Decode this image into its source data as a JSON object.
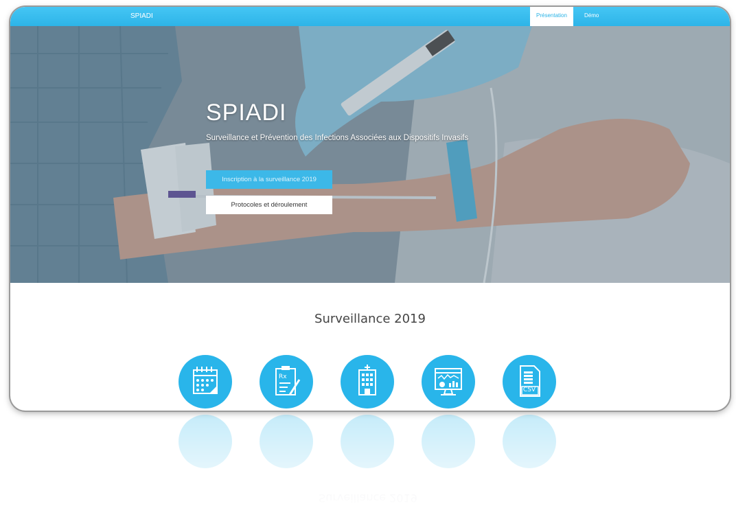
{
  "navbar": {
    "brand": "SPIADI",
    "tabs": [
      {
        "label": "Présentation",
        "active": true
      },
      {
        "label": "Démo",
        "active": false
      }
    ]
  },
  "hero": {
    "title": "SPIADI",
    "subtitle": "Surveillance et Prévention des Infections Associées aux Dispositifs Invasifs",
    "primary_button": "Inscription à la surveillance 2019",
    "secondary_button": "Protocoles et déroulement"
  },
  "section": {
    "title": "Surveillance 2019"
  },
  "feature_icons": [
    {
      "icon": "calendar-icon"
    },
    {
      "icon": "clipboard-prescription-icon"
    },
    {
      "icon": "hospital-building-icon"
    },
    {
      "icon": "monitor-chart-icon"
    },
    {
      "icon": "csv-file-icon",
      "label": "CSV"
    }
  ],
  "reflection_text": "Surveillance 2019",
  "colors": {
    "accent": "#2db4e8",
    "icon_circle": "#29b5ea",
    "white": "#ffffff"
  }
}
